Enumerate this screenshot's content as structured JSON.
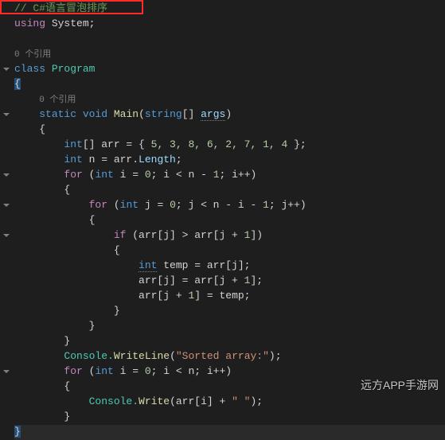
{
  "highlight_comment": "// C#语言冒泡排序",
  "code": {
    "l1": "using",
    "l1b": " System;",
    "ref0": "0 个引用",
    "l2a": "class",
    "l2b": " Program",
    "l3": "{",
    "ref1": "0 个引用",
    "l4a": "static",
    "l4b": " void",
    "l4c": " Main",
    "l4d": "(",
    "l4e": "string",
    "l4f": "[] ",
    "l4g": "args",
    "l4h": ")",
    "l5": "{",
    "l6a": "int",
    "l6b": "[] arr = { ",
    "l6n": "5, 3, 8, 6, 2, 7, 1, 4",
    "l6c": " };",
    "l7a": "int",
    "l7b": " n = arr.",
    "l7c": "Length",
    "l7d": ";",
    "l8a": "for",
    "l8b": " (",
    "l8c": "int",
    "l8d": " i = ",
    "l8n0": "0",
    "l8e": "; i < n - ",
    "l8n1": "1",
    "l8f": "; i++)",
    "l9": "{",
    "l10a": "for",
    "l10b": " (",
    "l10c": "int",
    "l10d": " j = ",
    "l10n0": "0",
    "l10e": "; j < n - i - ",
    "l10n1": "1",
    "l10f": "; j++)",
    "l11": "{",
    "l12a": "if",
    "l12b": " (arr[j] > arr[j + ",
    "l12n": "1",
    "l12c": "])",
    "l13": "{",
    "l14a": "int",
    "l14b": " temp = arr[j];",
    "l15": "arr[j] = arr[j + ",
    "l15n": "1",
    "l15b": "];",
    "l16": "arr[j + ",
    "l16n": "1",
    "l16b": "] = temp;",
    "l17": "}",
    "l18": "}",
    "l19": "}",
    "l20a": "Console.",
    "l20b": "WriteLine",
    "l20c": "(",
    "l20s": "\"Sorted array:\"",
    "l20d": ");",
    "l21a": "for",
    "l21b": " (",
    "l21c": "int",
    "l21d": " i = ",
    "l21n": "0",
    "l21e": "; i < n; i++)",
    "l22": "{",
    "l23a": "Console.",
    "l23b": "Write",
    "l23c": "(arr[i] + ",
    "l23s": "\" \"",
    "l23d": ");",
    "l24": "}",
    "l25": "}"
  },
  "watermark": "远方APP手游网"
}
